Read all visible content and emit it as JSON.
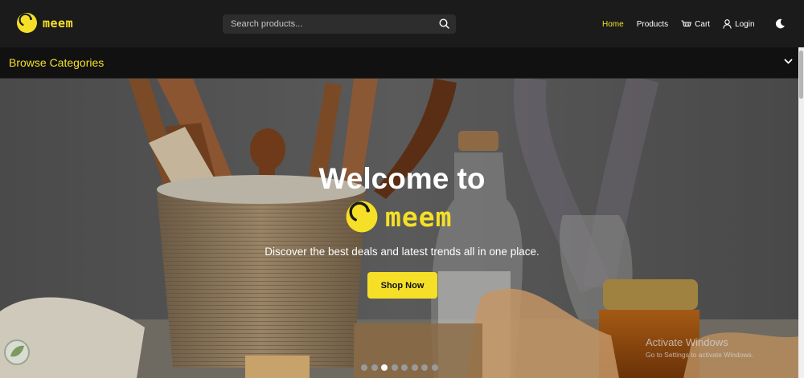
{
  "brand": {
    "name": "meem",
    "accent_color": "#f5e027"
  },
  "search": {
    "placeholder": "Search products...",
    "icon": "search-icon"
  },
  "nav": {
    "home": "Home",
    "products": "Products",
    "cart": "Cart",
    "login": "Login",
    "theme_icon": "moon-icon"
  },
  "categories": {
    "label": "Browse Categories",
    "icon": "chevron-down-icon"
  },
  "hero": {
    "title": "Welcome to",
    "brand": "meem",
    "subtitle": "Discover the best deals and latest trends all in one place.",
    "cta": "Shop Now",
    "slide_count": 8,
    "active_slide": 3
  },
  "watermark": {
    "title": "Activate Windows",
    "subtitle": "Go to Settings to activate Windows."
  }
}
